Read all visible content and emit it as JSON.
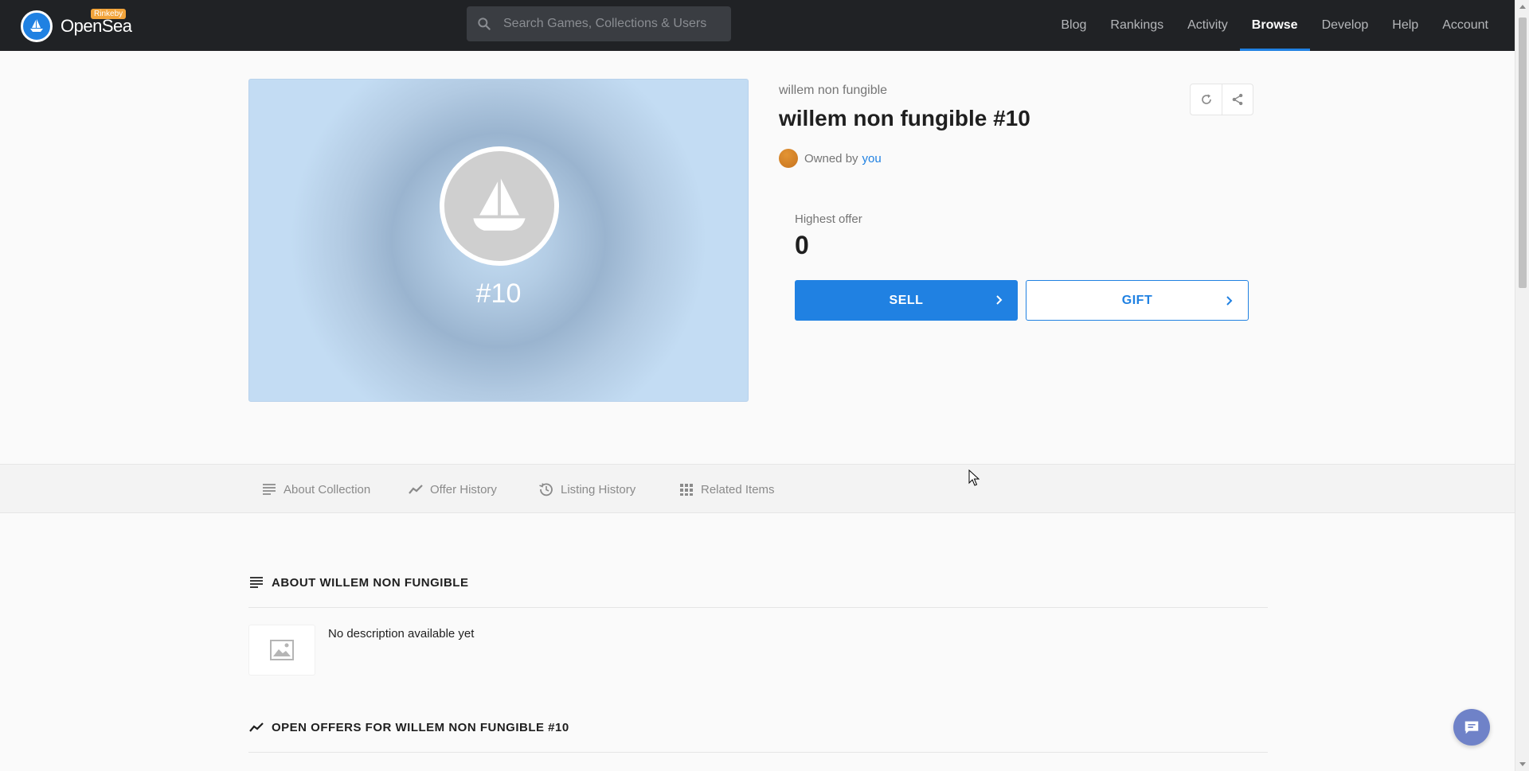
{
  "header": {
    "logo_text": "OpenSea",
    "network_badge": "Rinkeby",
    "search_placeholder": "Search Games, Collections & Users",
    "nav": [
      {
        "label": "Blog",
        "active": false
      },
      {
        "label": "Rankings",
        "active": false
      },
      {
        "label": "Activity",
        "active": false
      },
      {
        "label": "Browse",
        "active": true
      },
      {
        "label": "Develop",
        "active": false
      },
      {
        "label": "Help",
        "active": false
      },
      {
        "label": "Account",
        "active": false
      }
    ]
  },
  "asset": {
    "image_label": "#10",
    "collection_name": "willem non fungible",
    "title": "willem non fungible #10",
    "owned_by_prefix": "Owned by",
    "owner_link": "you",
    "highest_offer_label": "Highest offer",
    "highest_offer_value": "0",
    "sell_label": "SELL",
    "gift_label": "GIFT"
  },
  "tabs": [
    {
      "label": "About Collection",
      "icon": "lines-icon"
    },
    {
      "label": "Offer History",
      "icon": "trend-icon"
    },
    {
      "label": "Listing History",
      "icon": "history-icon"
    },
    {
      "label": "Related Items",
      "icon": "grid-icon"
    }
  ],
  "sections": {
    "about_title": "ABOUT WILLEM NON FUNGIBLE",
    "about_description": "No description available yet",
    "offers_title": "OPEN OFFERS FOR WILLEM NON FUNGIBLE #10"
  },
  "colors": {
    "accent": "#2081e2",
    "topbar": "#202225",
    "badge": "#f2a43b"
  }
}
